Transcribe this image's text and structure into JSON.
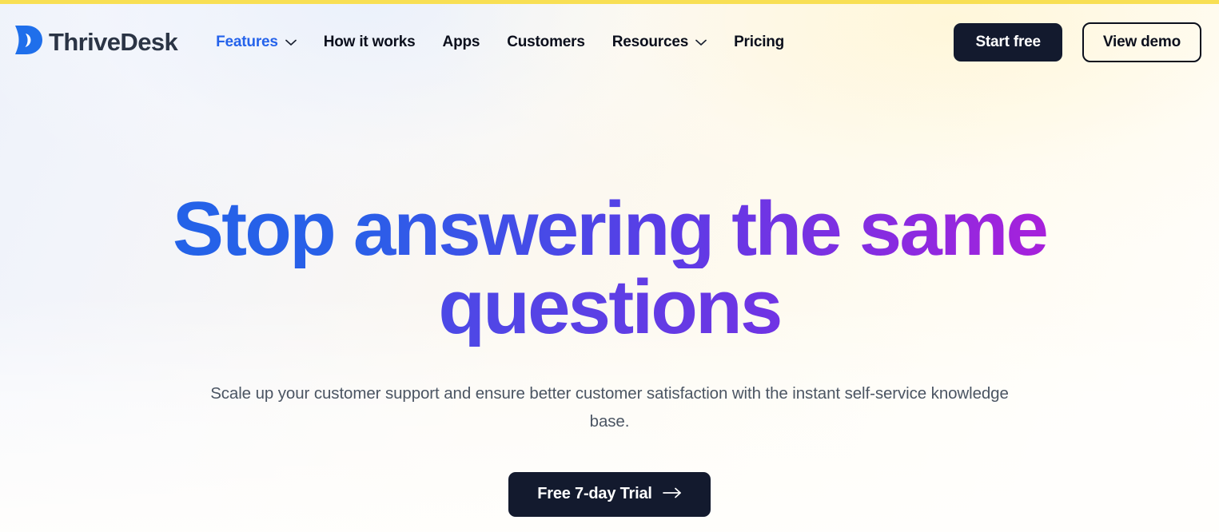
{
  "accent_top_bar_color": "#f8df54",
  "brand": {
    "name": "ThriveDesk",
    "logo_icon": "thrivedesk-d-logo-icon",
    "logo_color": "#1f6feb",
    "text_color": "#2b3445"
  },
  "nav": {
    "items": [
      {
        "label": "Features",
        "has_dropdown": true,
        "active": true,
        "icon": "chevron-down-icon"
      },
      {
        "label": "How it works",
        "has_dropdown": false,
        "active": false,
        "icon": ""
      },
      {
        "label": "Apps",
        "has_dropdown": false,
        "active": false,
        "icon": ""
      },
      {
        "label": "Customers",
        "has_dropdown": false,
        "active": false,
        "icon": ""
      },
      {
        "label": "Resources",
        "has_dropdown": true,
        "active": false,
        "icon": "chevron-down-icon"
      },
      {
        "label": "Pricing",
        "has_dropdown": false,
        "active": false,
        "icon": ""
      }
    ],
    "active_color": "#2563eb",
    "default_color": "#0b0f1c"
  },
  "header_actions": {
    "start_free_label": "Start free",
    "view_demo_label": "View demo",
    "primary_bg": "#131a2e",
    "primary_fg": "#ffffff",
    "outline_border": "#0b0f1c"
  },
  "hero": {
    "headline_line1": "Stop answering the same",
    "headline_line2": "questions",
    "headline_gradient_from": "#1f64e8",
    "headline_gradient_mid": "#8b2be0",
    "headline_gradient_to": "#c117d6",
    "subhead_line1": "Scale up your customer support and ensure better customer satisfaction with the instant self-service",
    "subhead_line2": "knowledge base.",
    "subhead_color": "#4b5563",
    "cta_label": "Free 7-day Trial",
    "cta_icon": "arrow-right-icon",
    "cta_bg": "#131a2e",
    "cta_fg": "#ffffff"
  },
  "background": {
    "gradient_left": "#eef2fa",
    "gradient_right": "#fffdf8"
  }
}
